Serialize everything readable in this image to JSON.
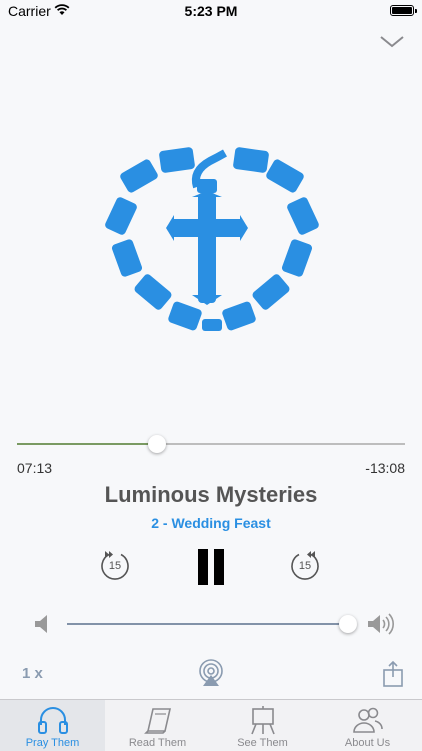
{
  "status_bar": {
    "carrier": "Carrier",
    "time": "5:23 PM"
  },
  "player": {
    "elapsed": "07:13",
    "remaining": "-13:08",
    "progress_fraction": 0.36,
    "title": "Luminous Mysteries",
    "subtitle": "2 - Wedding Feast",
    "skip_back_seconds": "15",
    "skip_forward_seconds": "15",
    "volume_fraction": 0.97,
    "speed": "1 x",
    "accent_color": "#2a8fe2",
    "artwork_icon": "rosary-heart-cross-icon"
  },
  "tabs": [
    {
      "label": "Pray Them",
      "icon": "headphones-icon",
      "active": true
    },
    {
      "label": "Read Them",
      "icon": "book-icon",
      "active": false
    },
    {
      "label": "See Them",
      "icon": "easel-icon",
      "active": false
    },
    {
      "label": "About Us",
      "icon": "people-icon",
      "active": false
    }
  ]
}
